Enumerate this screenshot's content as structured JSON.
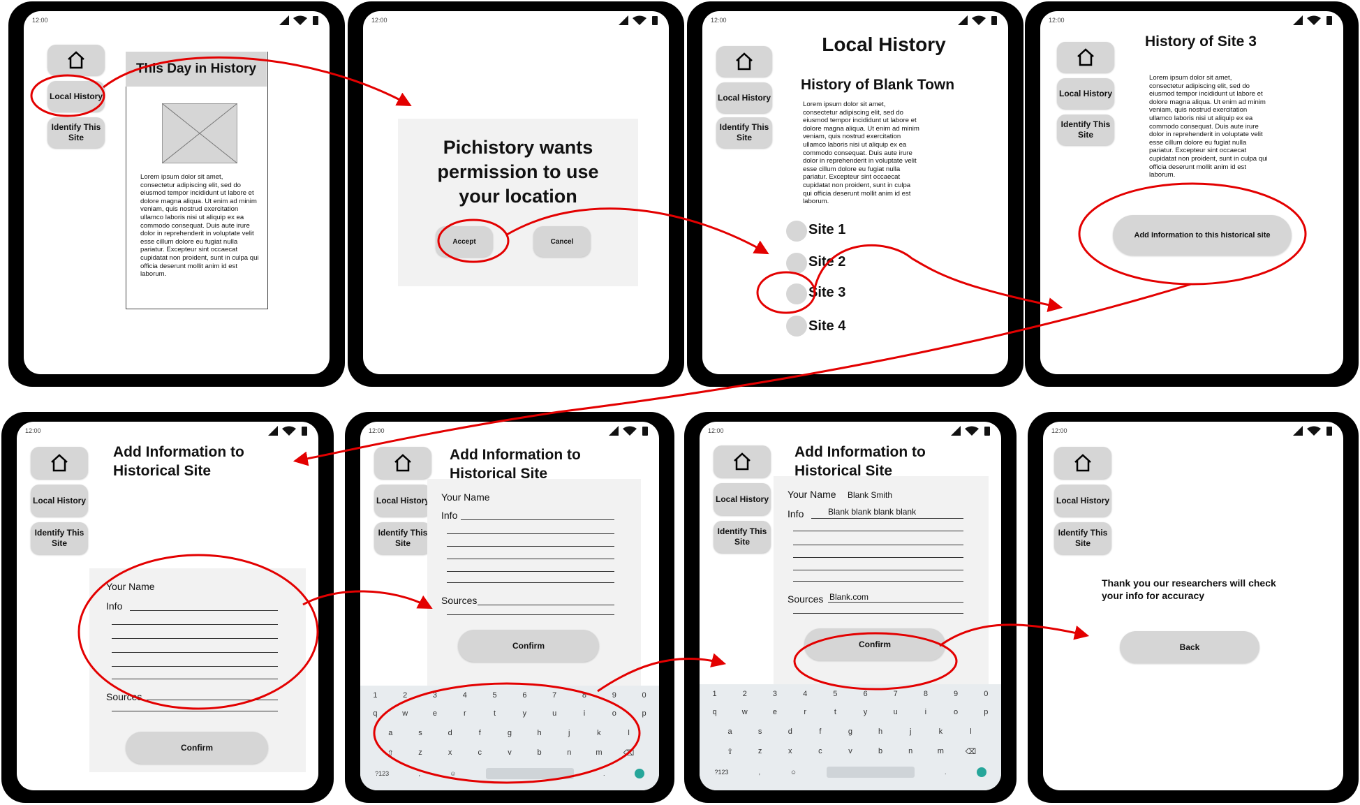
{
  "status": {
    "time": "12:00"
  },
  "nav": {
    "local_history": "Local History",
    "identify_site": "Identify This Site"
  },
  "lorem": "Lorem ipsum dolor sit amet, consectetur adipiscing elit, sed do eiusmod tempor incididunt ut labore et dolore magna aliqua. Ut enim ad minim veniam, quis nostrud exercitation ullamco laboris nisi ut aliquip ex ea commodo consequat. Duis aute irure dolor in reprehenderit in voluptate velit esse cillum dolore eu fugiat nulla pariatur. Excepteur sint occaecat cupidatat non proident, sunt in culpa qui officia deserunt mollit anim id est laborum.",
  "screen1": {
    "title": "This Day in History"
  },
  "screen2": {
    "dialog_title": "Pichistory wants permission to use your location",
    "accept": "Accept",
    "cancel": "Cancel"
  },
  "screen3": {
    "title": "Local History",
    "subtitle": "History of Blank Town",
    "sites": [
      "Site 1",
      "Site 2",
      "Site 3",
      "Site 4"
    ]
  },
  "screen4": {
    "title": "History of Site 3",
    "add_button": "Add Information to this historical site"
  },
  "form": {
    "title": "Add Information to Historical Site",
    "your_name": "Your Name",
    "info": "Info",
    "sources": "Sources",
    "confirm": "Confirm"
  },
  "screen7": {
    "name_value": "Blank Smith",
    "info_value": "Blank blank blank blank",
    "sources_value": "Blank.com"
  },
  "screen8": {
    "thanks": "Thank you our researchers will check your info for accuracy",
    "back": "Back"
  },
  "keyboard": {
    "row1": [
      "1",
      "2",
      "3",
      "4",
      "5",
      "6",
      "7",
      "8",
      "9",
      "0"
    ],
    "row2": [
      "q",
      "w",
      "e",
      "r",
      "t",
      "y",
      "u",
      "i",
      "o",
      "p"
    ],
    "row3": [
      "a",
      "s",
      "d",
      "f",
      "g",
      "h",
      "j",
      "k",
      "l"
    ],
    "row4": [
      "⇧",
      "z",
      "x",
      "c",
      "v",
      "b",
      "n",
      "m",
      "⌫"
    ],
    "row5_left": "?123",
    "row5_comma": ",",
    "row5_emoji": "☺",
    "row5_period": "."
  },
  "colors": {
    "annotation_red": "#e30000",
    "button_gray": "#d6d6d6",
    "panel_gray": "#f2f2f2"
  }
}
